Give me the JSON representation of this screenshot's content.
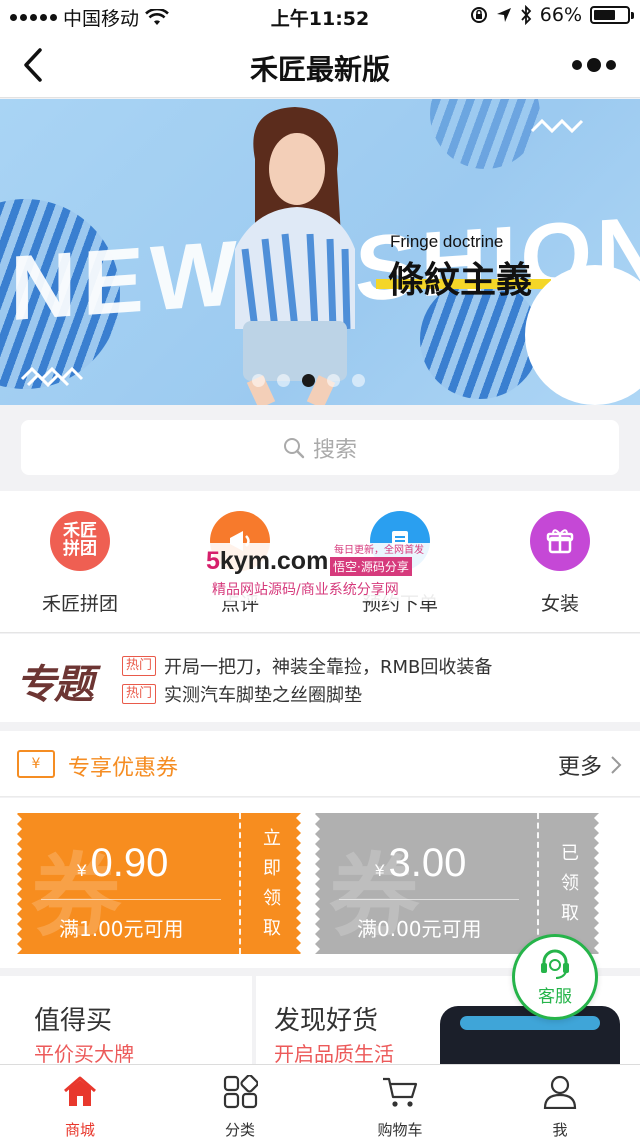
{
  "status_bar": {
    "carrier": "中国移动",
    "time": "上午11:52",
    "battery": "66%",
    "battery_level": 0.66
  },
  "nav": {
    "title": "禾匠最新版"
  },
  "banner": {
    "headline_left": "NEW",
    "headline_right": "SHION",
    "tagline_en": "Fringe doctrine",
    "tagline_cn": "條紋主義",
    "dots_count": 5,
    "active_dot": 2
  },
  "search": {
    "placeholder": "搜索"
  },
  "quick_entries": {
    "items": [
      {
        "label": "禾匠拼团",
        "icon_text": "禾匠\n拼团",
        "color": "#ef5f52"
      },
      {
        "label": "点评",
        "icon_text": "",
        "color": "#f77a2c"
      },
      {
        "label": "预约下单",
        "icon_text": "",
        "color": "#2a9ff0"
      },
      {
        "label": "女装",
        "icon_text": "",
        "color": "#c548d6"
      }
    ],
    "overlay": {
      "brand_prefix": "5",
      "brand": "kym.com",
      "tag": "悟空·源码分享",
      "top": "每日更新，全网首发",
      "sub": "精品网站源码/商业系统分享网"
    }
  },
  "topics": {
    "logo": "专题",
    "rows": [
      {
        "tag": "热门",
        "text": "开局一把刀，神装全靠捡，RMB回收装备"
      },
      {
        "tag": "热门",
        "text": "实测汽车脚垫之丝圈脚垫"
      }
    ]
  },
  "coupons": {
    "title": "专享优惠券",
    "more": "更多",
    "icon_text": "¥",
    "ghost": "券",
    "items": [
      {
        "currency": "¥",
        "amount": "0.90",
        "condition": "满1.00元可用",
        "action": "立即领取",
        "action_chars": [
          "立",
          "即",
          "领",
          "取"
        ],
        "color": "#f78d1f"
      },
      {
        "currency": "¥",
        "amount": "3.00",
        "condition": "满0.00元可用",
        "action": "已领取",
        "action_chars": [
          "已",
          "领",
          "取"
        ],
        "color": "#b0b0b0"
      }
    ]
  },
  "service": {
    "label": "客服"
  },
  "cards": [
    {
      "title": "值得买",
      "subtitle": "平价买大牌"
    },
    {
      "title": "发现好货",
      "subtitle": "开启品质生活"
    }
  ],
  "tabbar": {
    "tabs": [
      {
        "label": "商城",
        "active": true
      },
      {
        "label": "分类",
        "active": false
      },
      {
        "label": "购物车",
        "active": false
      },
      {
        "label": "我",
        "active": false
      }
    ]
  },
  "colors": {
    "accent_red": "#e8382d",
    "coupon_orange": "#f78d1f",
    "service_green": "#26b44a"
  }
}
